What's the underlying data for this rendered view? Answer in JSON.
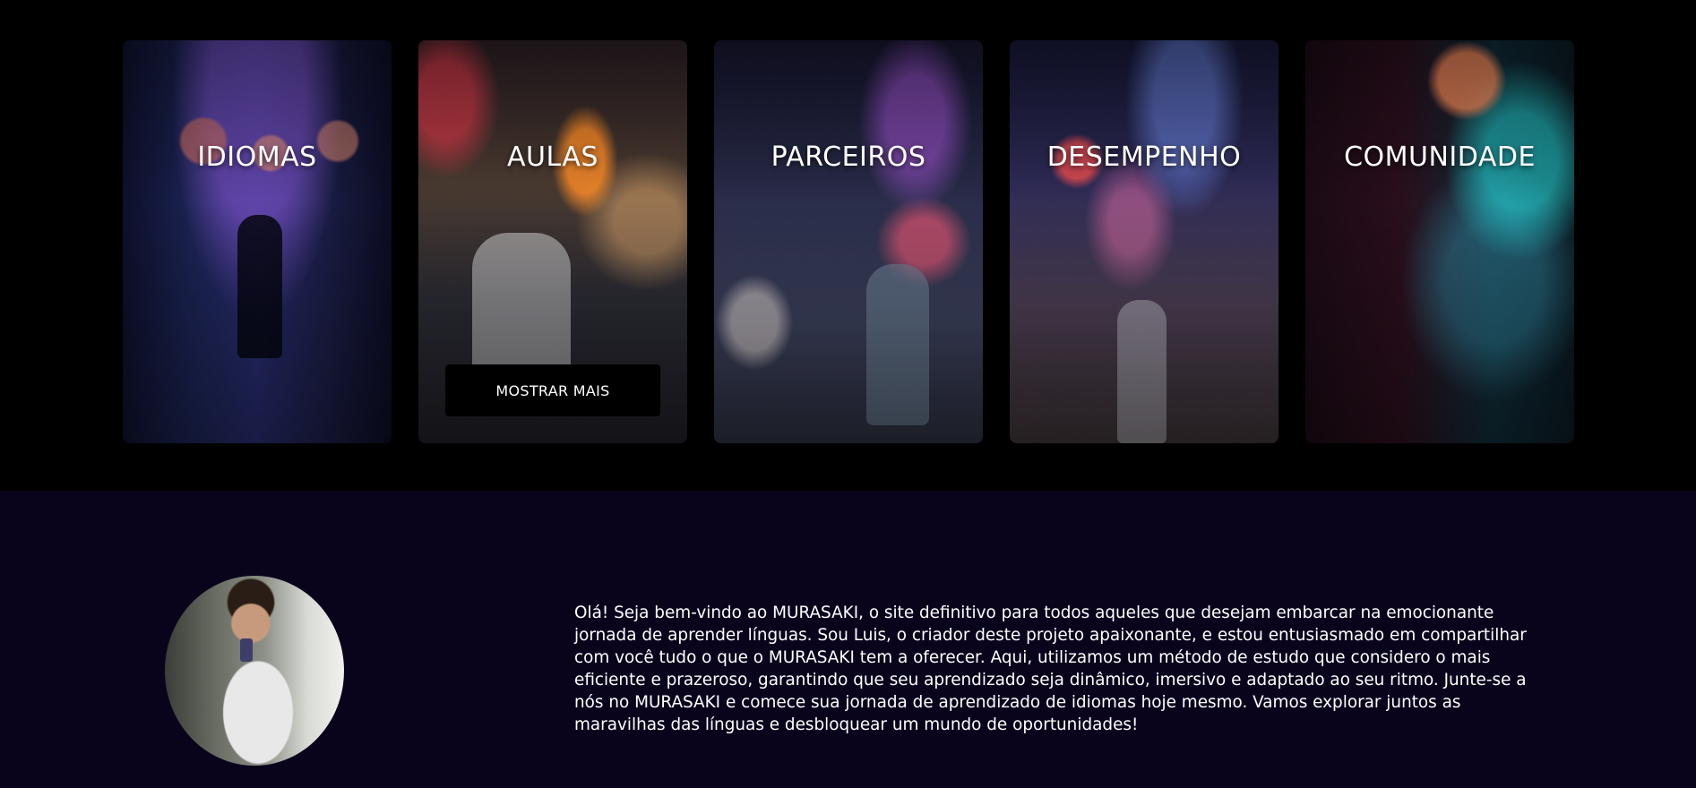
{
  "cards": [
    {
      "title": "IDIOMAS"
    },
    {
      "title": "AULAS",
      "button_label": "MOSTRAR MAIS"
    },
    {
      "title": "PARCEIROS"
    },
    {
      "title": "DESEMPENHO"
    },
    {
      "title": "COMUNIDADE"
    }
  ],
  "about": {
    "text": "Olá! Seja bem-vindo ao MURASAKI, o site definitivo para todos aqueles que desejam embarcar na emocionante jornada de aprender línguas. Sou Luis, o criador deste projeto apaixonante, e estou entusiasmado em compartilhar com você tudo o que o MURASAKI tem a oferecer. Aqui, utilizamos um método de estudo que considero o mais eficiente e prazeroso, garantindo que seu aprendizado seja dinâmico, imersivo e adaptado ao seu ritmo. Junte-se a nós no MURASAKI e comece sua jornada de aprendizado de idiomas hoje mesmo. Vamos explorar juntos as maravilhas das línguas e desbloquear um mundo de oportunidades!"
  },
  "colors": {
    "top_background": "#000000",
    "bottom_background": "#09041c",
    "text": "#ffffff",
    "button_background": "#000000"
  }
}
